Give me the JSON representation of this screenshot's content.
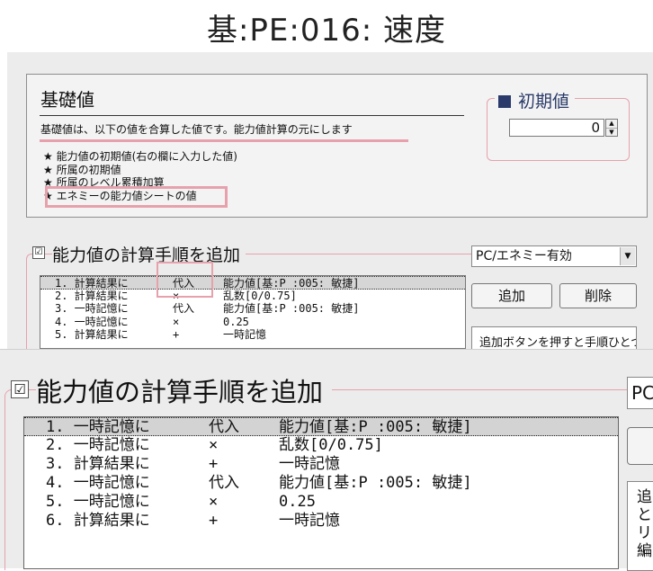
{
  "window": {
    "title": "基:PE:016: 速度"
  },
  "base": {
    "title": "基礎値",
    "description": "基礎値は、以下の値を合算した値です。能力値計算の元にします",
    "items": [
      "★ 能力値の初期値(右の欄に入力した値)",
      "★ 所属の初期値",
      "★ 所属のレベル累積加算",
      "★ エネミーの能力値シートの値"
    ]
  },
  "initial": {
    "title": "初期値",
    "value": "0"
  },
  "calc": {
    "checkbox_mark": "☑",
    "title": "能力値の計算手順を追加",
    "select_value": "PC/エネミー有効",
    "add_label": "追加",
    "delete_label": "削除",
    "hint": "追加ボタンを押すと手順ひとつ分を追加。リストのリスト編",
    "rows_small": [
      {
        "n": "1. 計算結果に",
        "op": "代入",
        "val": "能力値[基:P :005: 敏捷]"
      },
      {
        "n": "2. 計算結果に",
        "op": "×",
        "val": "乱数[0/0.75]"
      },
      {
        "n": "3. 一時記憶に",
        "op": "代入",
        "val": "能力値[基:P :005: 敏捷]"
      },
      {
        "n": "4. 一時記憶に",
        "op": "×",
        "val": "0.25"
      },
      {
        "n": "5. 計算結果に",
        "op": "+",
        "val": "一時記憶"
      }
    ]
  },
  "zoom": {
    "title": "能力値の計算手順を追加",
    "select_value": "PC",
    "hint": "追\nと\nリ\n編",
    "rows": [
      {
        "n": "1. 一時記憶に",
        "op": "代入",
        "val": "能力値[基:P :005: 敏捷]"
      },
      {
        "n": "2. 一時記憶に",
        "op": "×",
        "val": "乱数[0/0.75]"
      },
      {
        "n": "3. 計算結果に",
        "op": "+",
        "val": "一時記憶"
      },
      {
        "n": "4. 一時記憶に",
        "op": "代入",
        "val": "能力値[基:P :005: 敏捷]"
      },
      {
        "n": "5. 一時記憶に",
        "op": "×",
        "val": "0.25"
      },
      {
        "n": "6. 計算結果に",
        "op": "+",
        "val": "一時記憶"
      }
    ]
  },
  "colors": {
    "accent_pink": "#e7a1ac",
    "title_navy": "#2a3a6a",
    "selection": "#d6d6d6"
  }
}
